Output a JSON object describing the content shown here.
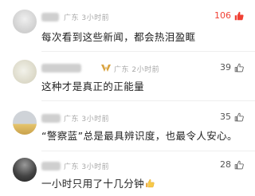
{
  "comments": [
    {
      "meta": "广东 3小时前",
      "text": "每次看到这些新闻，都会热泪盈眶",
      "likes": "106",
      "liked_hot": true
    },
    {
      "meta": "广东 2小时前",
      "text": "这种才是真正的正能量",
      "likes": "39",
      "liked_hot": false
    },
    {
      "meta": "广东 3小时前",
      "text": "“警察蓝”总是最具辨识度，也最令人安心。",
      "likes": "35",
      "liked_hot": false
    },
    {
      "meta": "广东 3小时前",
      "text": "一小时只用了十几分钟",
      "likes": "28",
      "liked_hot": false,
      "trailing_emoji": "thumbs-up-emoji"
    }
  ],
  "colors": {
    "hot_like": "#f04134",
    "meta_text": "#a8a8a8",
    "badge_gold": "#d9a441"
  }
}
